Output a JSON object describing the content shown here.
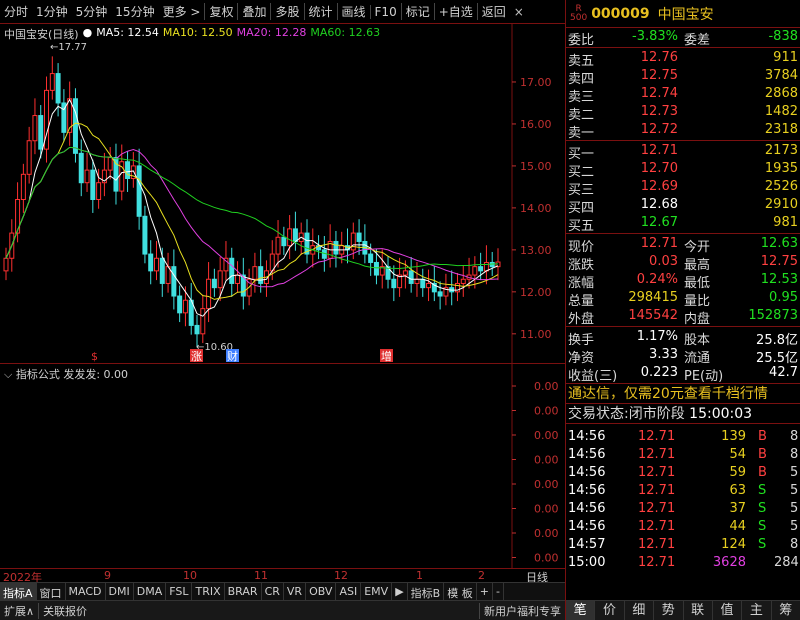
{
  "toolbar": {
    "items": [
      "分时",
      "1分钟",
      "5分钟",
      "15分钟",
      "更多 >",
      "复权",
      "叠加",
      "多股",
      "统计",
      "画线",
      "F10",
      "标记",
      "+自选",
      "返回"
    ],
    "close": "×"
  },
  "main_chart": {
    "title": "中国宝安(日线)",
    "ma5": "MA5: 12.54",
    "ma10": "MA10: 12.50",
    "ma20": "MA20: 12.28",
    "ma60": "MA60: 12.63",
    "y_ticks": [
      "17.00",
      "16.00",
      "15.00",
      "14.00",
      "13.00",
      "12.00",
      "11.00"
    ],
    "high_label": "17.77",
    "low_label": "10.60",
    "markers": [
      "$",
      "涨",
      "财",
      "增"
    ],
    "colors": {
      "up": "#ff3030",
      "down": "#40e0e0",
      "ma5": "#ffffff",
      "ma10": "#e8e020",
      "ma20": "#e040e0",
      "ma60": "#20d020"
    }
  },
  "indicator": {
    "title": "指标公式  发发发: 0.00",
    "y_ticks": [
      "0.00",
      "0.00",
      "0.00",
      "0.00",
      "0.00",
      "0.00",
      "0.00",
      "0.00"
    ]
  },
  "time_axis": {
    "labels": [
      "2022年",
      "9",
      "10",
      "11",
      "12",
      "1",
      "2"
    ],
    "right": "日线"
  },
  "tabs": [
    "指标A",
    "窗口",
    "MACD",
    "DMI",
    "DMA",
    "FSL",
    "TRIX",
    "BRAR",
    "CR",
    "VR",
    "OBV",
    "ASI",
    "EMV",
    "▶",
    "指标B",
    "模 板",
    "+",
    "-"
  ],
  "status": {
    "left1": "扩展∧",
    "left2": "关联报价",
    "right": "新用户福利专享"
  },
  "chart_data": {
    "type": "candlestick",
    "title": "中国宝安(日线)",
    "y_range": [
      10.4,
      18.0
    ],
    "x_labels": [
      "2022年",
      "9",
      "10",
      "11",
      "12",
      "1",
      "2"
    ],
    "ma": {
      "MA5": 12.54,
      "MA10": 12.5,
      "MA20": 12.28,
      "MA60": 12.63
    },
    "closes": [
      12.8,
      13.4,
      14.2,
      14.8,
      15.6,
      16.2,
      15.4,
      16.8,
      17.2,
      16.5,
      15.8,
      16.6,
      15.3,
      14.6,
      14.9,
      14.2,
      14.6,
      14.9,
      15.2,
      14.4,
      15.1,
      14.7,
      15.0,
      13.8,
      12.9,
      12.5,
      12.8,
      12.2,
      12.6,
      11.9,
      11.5,
      11.8,
      11.2,
      11.0,
      11.6,
      12.3,
      12.1,
      12.5,
      12.8,
      12.2,
      12.4,
      11.9,
      12.3,
      12.6,
      12.2,
      12.5,
      12.9,
      13.3,
      13.1,
      13.5,
      13.2,
      13.4,
      12.9,
      13.1,
      13.0,
      12.8,
      13.2,
      12.9,
      13.1,
      13.0,
      13.4,
      13.2,
      12.9,
      12.7,
      12.4,
      12.6,
      12.3,
      12.1,
      12.4,
      12.5,
      12.2,
      12.3,
      12.1,
      12.2,
      12.0,
      11.9,
      12.1,
      12.0,
      12.2,
      12.3,
      12.4,
      12.6,
      12.5,
      12.7,
      12.6,
      12.71
    ]
  },
  "quote": {
    "badge_r": "R",
    "badge_num": "500",
    "code": "000009",
    "name": "中国宝安",
    "weibi_label": "委比",
    "weibi": "-3.83%",
    "weicha_label": "委差",
    "weicha": "-838",
    "sell": [
      {
        "label": "卖五",
        "price": "12.76",
        "vol": "911"
      },
      {
        "label": "卖四",
        "price": "12.75",
        "vol": "3784"
      },
      {
        "label": "卖三",
        "price": "12.74",
        "vol": "2868"
      },
      {
        "label": "卖二",
        "price": "12.73",
        "vol": "1482"
      },
      {
        "label": "卖一",
        "price": "12.72",
        "vol": "2318"
      }
    ],
    "buy": [
      {
        "label": "买一",
        "price": "12.71",
        "vol": "2173"
      },
      {
        "label": "买二",
        "price": "12.70",
        "vol": "1935"
      },
      {
        "label": "买三",
        "price": "12.69",
        "vol": "2526"
      },
      {
        "label": "买四",
        "price": "12.68",
        "vol": "2910"
      },
      {
        "label": "买五",
        "price": "12.67",
        "vol": "981"
      }
    ],
    "stats": [
      {
        "l1": "现价",
        "v1": "12.71",
        "c1": "red",
        "l2": "今开",
        "v2": "12.63",
        "c2": "green"
      },
      {
        "l1": "涨跌",
        "v1": "0.03",
        "c1": "red",
        "l2": "最高",
        "v2": "12.75",
        "c2": "red"
      },
      {
        "l1": "涨幅",
        "v1": "0.24%",
        "c1": "red",
        "l2": "最低",
        "v2": "12.53",
        "c2": "green"
      },
      {
        "l1": "总量",
        "v1": "298415",
        "c1": "yellow",
        "l2": "量比",
        "v2": "0.95",
        "c2": "green"
      },
      {
        "l1": "外盘",
        "v1": "145542",
        "c1": "red",
        "l2": "内盘",
        "v2": "152873",
        "c2": "green"
      }
    ],
    "fund": [
      {
        "l1": "换手",
        "v1": "1.17%",
        "l2": "股本",
        "v2": "25.8亿"
      },
      {
        "l1": "净资",
        "v1": "3.33",
        "l2": "流通",
        "v2": "25.5亿"
      },
      {
        "l1": "收益(三)",
        "v1": "0.223",
        "l2": "PE(动)",
        "v2": "42.7"
      }
    ],
    "banner": "通达信，仅需20元查看千档行情",
    "trade_state_label": "交易状态:闭市阶段",
    "trade_state_time": "15:00:03",
    "ticks": [
      {
        "t": "14:56",
        "p": "12.71",
        "v": "139",
        "d": "B",
        "n": "8"
      },
      {
        "t": "14:56",
        "p": "12.71",
        "v": "54",
        "d": "B",
        "n": "8"
      },
      {
        "t": "14:56",
        "p": "12.71",
        "v": "59",
        "d": "B",
        "n": "5"
      },
      {
        "t": "14:56",
        "p": "12.71",
        "v": "63",
        "d": "S",
        "n": "5"
      },
      {
        "t": "14:56",
        "p": "12.71",
        "v": "37",
        "d": "S",
        "n": "5"
      },
      {
        "t": "14:56",
        "p": "12.71",
        "v": "44",
        "d": "S",
        "n": "5"
      },
      {
        "t": "14:57",
        "p": "12.71",
        "v": "124",
        "d": "S",
        "n": "8"
      },
      {
        "t": "15:00",
        "p": "12.71",
        "v": "3628",
        "d": "",
        "n": "284"
      }
    ],
    "tabs": [
      "笔",
      "价",
      "细",
      "势",
      "联",
      "值",
      "主",
      "筹"
    ]
  }
}
